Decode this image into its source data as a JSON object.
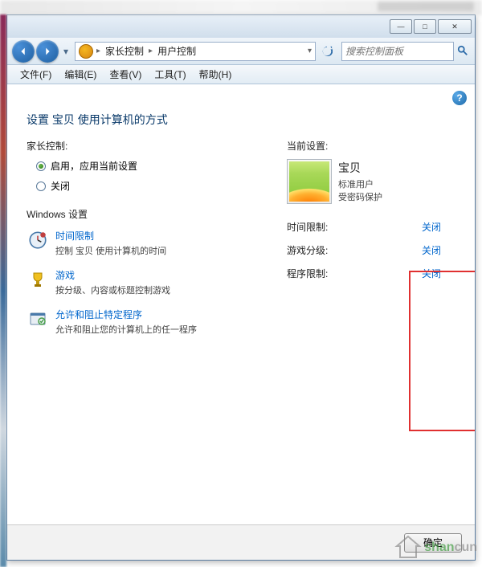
{
  "window_controls": {
    "min": "—",
    "max": "□",
    "close": "✕"
  },
  "breadcrumb": {
    "item1": "家长控制",
    "item2": "用户控制"
  },
  "search": {
    "placeholder": "搜索控制面板"
  },
  "menu": {
    "file": "文件(F)",
    "edit": "编辑(E)",
    "view": "查看(V)",
    "tools": "工具(T)",
    "help": "帮助(H)"
  },
  "page": {
    "title": "设置 宝贝 使用计算机的方式",
    "parental_label": "家长控制:",
    "radio_on": "启用，应用当前设置",
    "radio_off": "关闭",
    "win_settings_label": "Windows 设置",
    "current_settings_label": "当前设置:"
  },
  "settings": [
    {
      "title": "时间限制",
      "desc": "控制 宝贝 使用计算机的时间"
    },
    {
      "title": "游戏",
      "desc": "按分级、内容或标题控制游戏"
    },
    {
      "title": "允许和阻止特定程序",
      "desc": "允许和阻止您的计算机上的任一程序"
    }
  ],
  "user": {
    "name": "宝贝",
    "role": "标准用户",
    "protected": "受密码保护"
  },
  "status": [
    {
      "label": "时间限制:",
      "value": "关闭"
    },
    {
      "label": "游戏分级:",
      "value": "关闭"
    },
    {
      "label": "程序限制:",
      "value": "关闭"
    }
  ],
  "footer": {
    "ok": "确定"
  },
  "watermark": {
    "t1": "shan",
    "t2": "cun"
  }
}
